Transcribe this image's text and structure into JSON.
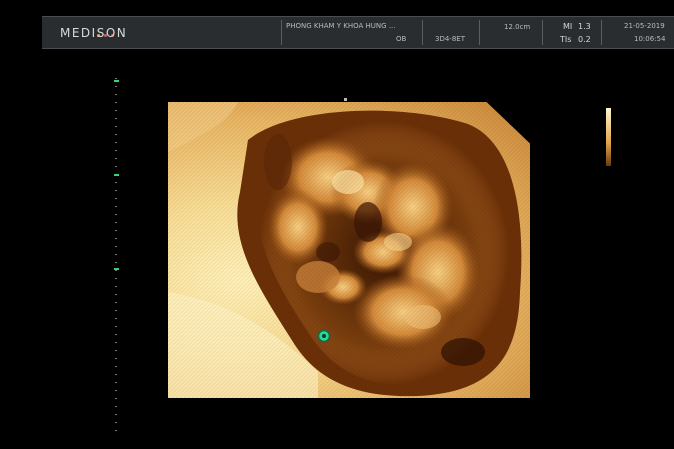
{
  "header": {
    "brand": "MEDISON",
    "brand_dot_colors": [
      "#e0a34a",
      "#d45a55",
      "#d45a55"
    ],
    "clinic": "PHONG KHAM Y KHOA HUNG ...",
    "preset": "OB",
    "probe": "3D4-8ET",
    "depth": "12.0cm",
    "mi_label": "MI",
    "mi_value": "1.3",
    "tis_label": "TIs",
    "tis_value": "0.2",
    "date": "21-05-2019",
    "time": "10:06:54"
  },
  "colors": {
    "background": "#000000",
    "header_bar": "#2a2d30",
    "scale_marker": "#3fcf7a",
    "render_tint": "#e9b766"
  },
  "icons": {
    "cursor": "green-marker-icon"
  }
}
